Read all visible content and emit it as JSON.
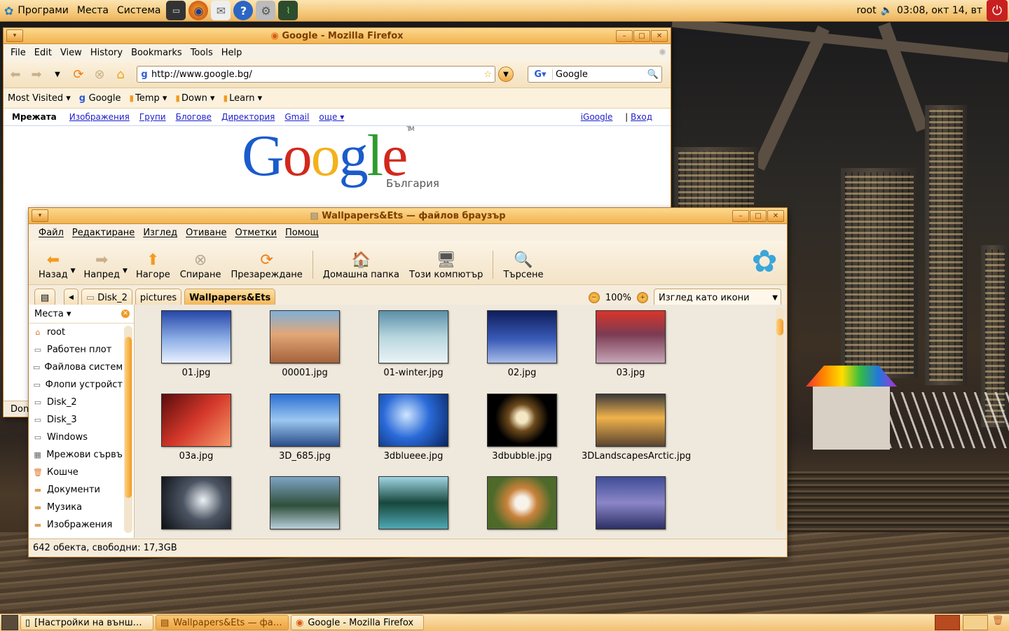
{
  "top_panel": {
    "menu_applications": "Програми",
    "menu_places": "Места",
    "menu_system": "Система",
    "launchers": [
      "terminal-icon",
      "firefox-icon",
      "mail-icon",
      "help-icon",
      "settings-icon",
      "system-monitor-icon"
    ],
    "user": "root",
    "clock": "03:08, окт 14, вт"
  },
  "firefox": {
    "title": "Google - Mozilla Firefox",
    "menu": [
      "File",
      "Edit",
      "View",
      "History",
      "Bookmarks",
      "Tools",
      "Help"
    ],
    "url": "http://www.google.bg/",
    "search_value": "Google",
    "bookmarks": [
      "Most Visited",
      "Google",
      "Temp",
      "Down",
      "Learn"
    ],
    "google_links": [
      "Мрежата",
      "Изображения",
      "Групи",
      "Блогове",
      "Директория",
      "Gmail",
      "още"
    ],
    "google_right": [
      "iGoogle",
      "Вход"
    ],
    "logo_country": "България",
    "logo_tm": "TM",
    "status": "Done"
  },
  "nautilus": {
    "title": "Wallpapers&Ets — файлов браузър",
    "menu": [
      "Файл",
      "Редактиране",
      "Изглед",
      "Отиване",
      "Отметки",
      "Помощ"
    ],
    "toolbar": {
      "back": "Назад",
      "forward": "Напред",
      "up": "Нагоре",
      "stop": "Спиране",
      "reload": "Презареждане",
      "home": "Домашна папка",
      "computer": "Този компютър",
      "search": "Търсене"
    },
    "path": [
      "Disk_2",
      "pictures",
      "Wallpapers&Ets"
    ],
    "zoom": "100%",
    "view_mode": "Изглед като икони",
    "sidebar_title": "Места",
    "places": [
      "root",
      "Работен плот",
      "Файлова систем",
      "Флопи устройст",
      "Disk_2",
      "Disk_3",
      "Windows",
      "Мрежови сървъ",
      "Кошче",
      "Документи",
      "Музика",
      "Изображения"
    ],
    "files": [
      "01.jpg",
      "00001.jpg",
      "01-winter.jpg",
      "02.jpg",
      "03.jpg",
      "03a.jpg",
      "3D_685.jpg",
      "3dblueee.jpg",
      "3dbubble.jpg",
      "3DLandscapesArctic.jpg"
    ],
    "status": "642 обекта, свободни: 17,3GB"
  },
  "taskbar": {
    "tasks": [
      "[Настройки на външ…",
      "Wallpapers&Ets — фа…",
      "Google - Mozilla Firefox"
    ]
  },
  "colors": {
    "panel": "#f5c97a",
    "title_text": "#7a3d00",
    "link": "#2020cc"
  }
}
